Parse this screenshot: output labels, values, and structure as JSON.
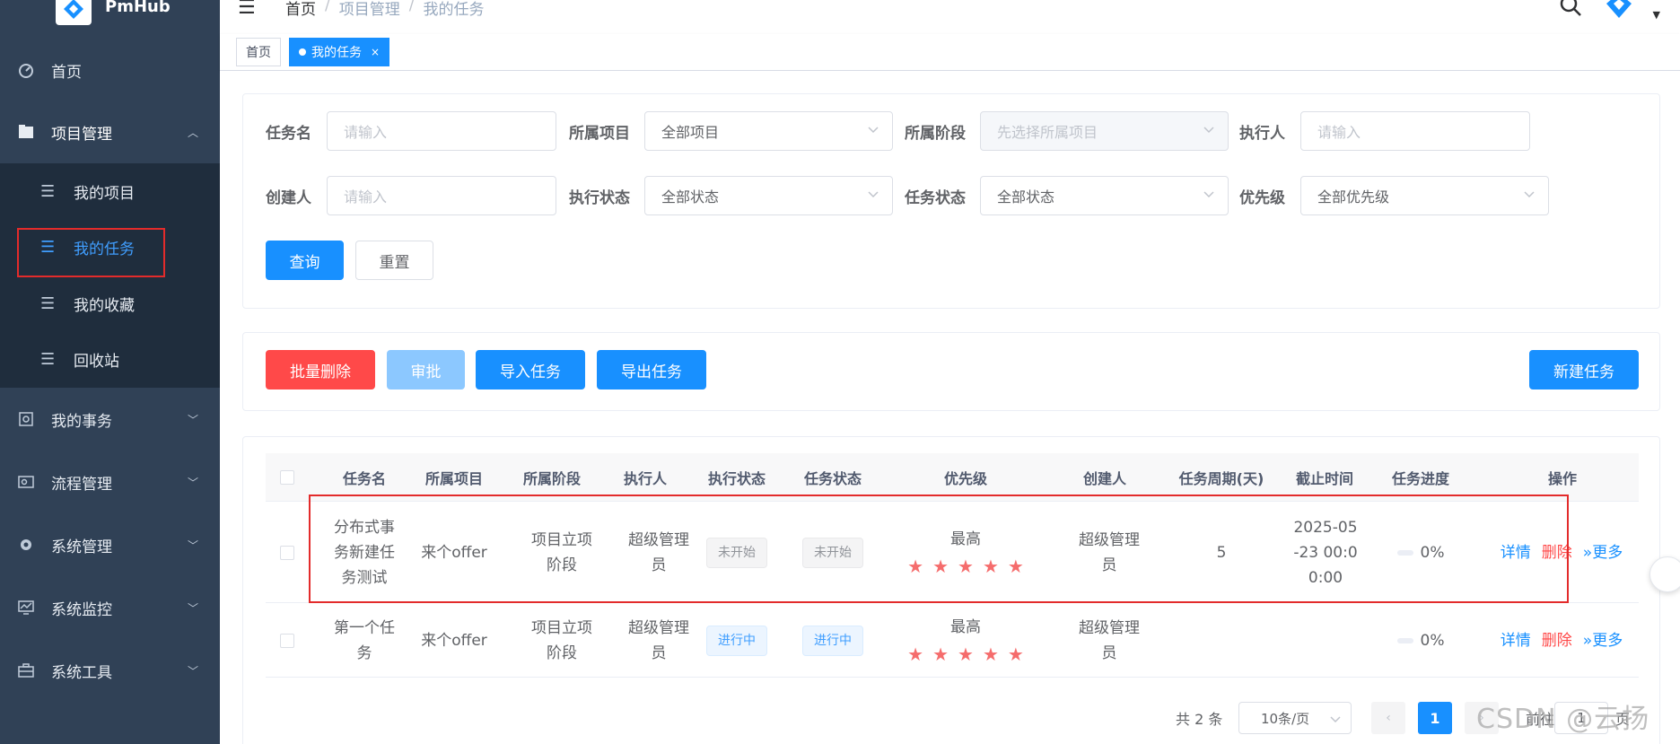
{
  "app": {
    "name": "PmHub",
    "accent": "#1890ff",
    "danger": "#ff4949"
  },
  "navbar": {
    "breadcrumb": [
      "首页",
      "项目管理",
      "我的任务"
    ],
    "search_icon": "search-icon",
    "avatar_icon": "pmhub-logo-icon"
  },
  "sidebar": {
    "items": [
      {
        "label": "首页",
        "icon": "dashboard-icon"
      },
      {
        "label": "项目管理",
        "icon": "folder-icon",
        "expanded": true
      },
      {
        "label": "我的项目",
        "icon": "list-icon"
      },
      {
        "label": "我的任务",
        "icon": "list-icon",
        "active": true
      },
      {
        "label": "我的收藏",
        "icon": "list-icon"
      },
      {
        "label": "回收站",
        "icon": "list-icon"
      },
      {
        "label": "我的事务",
        "icon": "monitor-icon"
      },
      {
        "label": "流程管理",
        "icon": "flow-icon"
      },
      {
        "label": "系统管理",
        "icon": "gear-icon"
      },
      {
        "label": "系统监控",
        "icon": "chart-monitor-icon"
      },
      {
        "label": "系统工具",
        "icon": "toolbox-icon"
      }
    ]
  },
  "tags": [
    {
      "label": "首页"
    },
    {
      "label": "我的任务",
      "active": true,
      "close": "×"
    }
  ],
  "search": {
    "task_name": {
      "label": "任务名",
      "placeholder": "请输入"
    },
    "project": {
      "label": "所属项目",
      "value": "全部项目"
    },
    "stage": {
      "label": "所属阶段",
      "placeholder": "先选择所属项目"
    },
    "executor": {
      "label": "执行人",
      "placeholder": "请输入"
    },
    "creator": {
      "label": "创建人",
      "placeholder": "请输入"
    },
    "exec_status": {
      "label": "执行状态",
      "value": "全部状态"
    },
    "task_status": {
      "label": "任务状态",
      "value": "全部状态"
    },
    "priority": {
      "label": "优先级",
      "value": "全部优先级"
    },
    "query_label": "查询",
    "reset_label": "重置"
  },
  "toolbar": {
    "batch_delete": "批量删除",
    "approve": "审批",
    "import": "导入任务",
    "export": "导出任务",
    "new_task": "新建任务"
  },
  "table": {
    "columns": [
      "任务名",
      "所属项目",
      "所属阶段",
      "执行人",
      "执行状态",
      "任务状态",
      "优先级",
      "创建人",
      "任务周期(天)",
      "截止时间",
      "任务进度",
      "操作"
    ],
    "rows": [
      {
        "name": "分布式事务新建任务测试",
        "project": "来个offer",
        "stage": "项目立项阶段",
        "executor": "超级管理员",
        "exec_status": "未开始",
        "task_status": "未开始",
        "priority": "最高",
        "stars": 5,
        "creator": "超级管理员",
        "cycle": "5",
        "deadline": "2025-05-23 00:00:00",
        "progress": 0,
        "progress_text": "0%",
        "op_detail": "详情",
        "op_delete": "删除",
        "op_more": "更多"
      },
      {
        "name": "第一个任务",
        "project": "来个offer",
        "stage": "项目立项阶段",
        "executor": "超级管理员",
        "exec_status": "进行中",
        "task_status": "进行中",
        "priority": "最高",
        "stars": 5,
        "creator": "超级管理员",
        "cycle": "",
        "deadline": "",
        "progress": 0,
        "progress_text": "0%",
        "op_detail": "详情",
        "op_delete": "删除",
        "op_more": "更多"
      }
    ]
  },
  "pagination": {
    "total": "共 2 条",
    "page_size": "10条/页",
    "current_page": "1",
    "goto_prefix": "前往",
    "goto_value": "1",
    "goto_suffix": "页"
  },
  "watermark": "CSDN @云扬"
}
